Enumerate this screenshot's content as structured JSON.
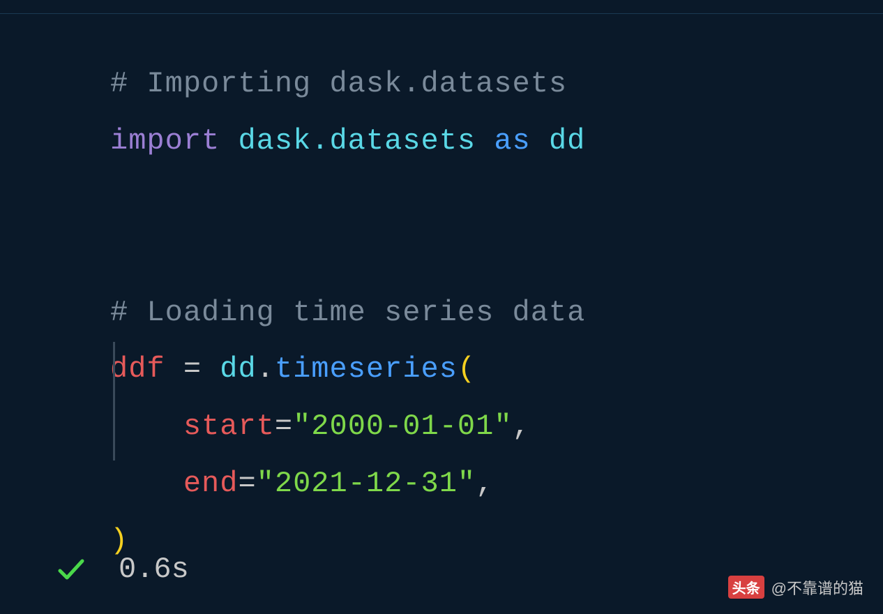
{
  "code": {
    "comment1": "# Importing dask.datasets",
    "import_kw": "import",
    "module": "dask.datasets",
    "as_kw": "as",
    "alias": "dd",
    "comment2": "# Loading time series data",
    "var": "ddf",
    "eq": " = ",
    "obj": "dd",
    "dot": ".",
    "func": "timeseries",
    "open_paren": "(",
    "param1": "start",
    "assign1": "=",
    "val1": "\"2000-01-01\"",
    "comma1": ",",
    "param2": "end",
    "assign2": "=",
    "val2": "\"2021-12-31\"",
    "comma2": ",",
    "close_paren": ")"
  },
  "status": {
    "time": "0.6s"
  },
  "watermark": {
    "badge": "头条",
    "text": "@不靠谱的猫"
  }
}
